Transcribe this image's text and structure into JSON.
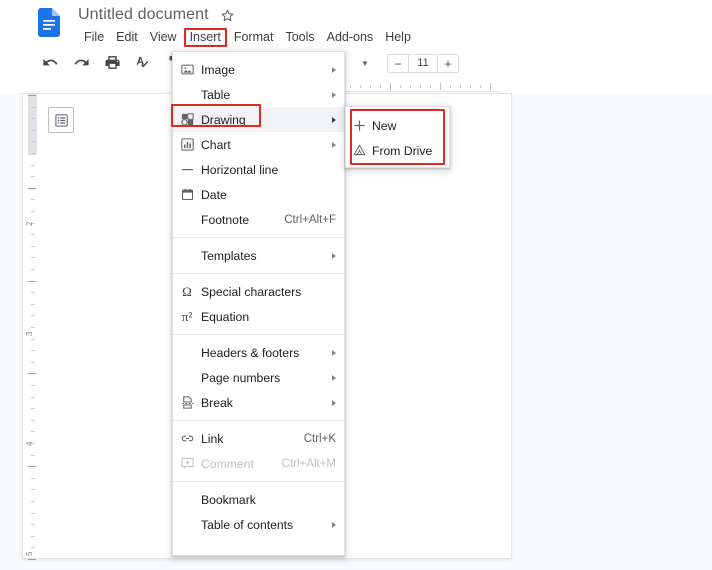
{
  "app": {
    "logo_icon": "google-docs-logo",
    "document_title": "Untitled document",
    "star_icon": "☆"
  },
  "menubar": {
    "items": [
      {
        "label": "File",
        "highlighted": false
      },
      {
        "label": "Edit",
        "highlighted": false
      },
      {
        "label": "View",
        "highlighted": false
      },
      {
        "label": "Insert",
        "highlighted": true
      },
      {
        "label": "Format",
        "highlighted": false
      },
      {
        "label": "Tools",
        "highlighted": false
      },
      {
        "label": "Add-ons",
        "highlighted": false
      },
      {
        "label": "Help",
        "highlighted": false
      }
    ]
  },
  "toolbar": {
    "icons": [
      {
        "name": "undo-icon"
      },
      {
        "name": "redo-icon"
      },
      {
        "name": "print-icon"
      },
      {
        "name": "spellcheck-icon"
      },
      {
        "name": "paint-format-icon"
      }
    ],
    "font_size": {
      "value": "11",
      "decrease_label": "−",
      "increase_label": "+"
    },
    "dropdown_caret": "▼"
  },
  "ruler": {
    "vertical_numbers": [
      "2",
      "3",
      "4",
      "5"
    ]
  },
  "document": {
    "outline_icon": "document-outline-icon"
  },
  "insert_menu": {
    "items": [
      {
        "label": "Image",
        "icon": "image-icon",
        "accel": "",
        "submenu": true,
        "separator_after": false,
        "disabled": false,
        "selected": false
      },
      {
        "label": "Table",
        "icon": "",
        "accel": "",
        "submenu": true,
        "separator_after": false,
        "disabled": false,
        "selected": false
      },
      {
        "label": "Drawing",
        "icon": "drawing-icon",
        "accel": "",
        "submenu": true,
        "separator_after": false,
        "disabled": false,
        "selected": true
      },
      {
        "label": "Chart",
        "icon": "chart-icon",
        "accel": "",
        "submenu": true,
        "separator_after": false,
        "disabled": false,
        "selected": false
      },
      {
        "label": "Horizontal line",
        "icon": "horizontal-line-icon",
        "accel": "",
        "submenu": false,
        "separator_after": false,
        "disabled": false,
        "selected": false
      },
      {
        "label": "Date",
        "icon": "date-icon",
        "accel": "",
        "submenu": false,
        "separator_after": false,
        "disabled": false,
        "selected": false
      },
      {
        "label": "Footnote",
        "icon": "",
        "accel": "Ctrl+Alt+F",
        "submenu": false,
        "separator_after": true,
        "disabled": false,
        "selected": false
      },
      {
        "label": "Templates",
        "icon": "",
        "accel": "",
        "submenu": true,
        "separator_after": true,
        "disabled": false,
        "selected": false
      },
      {
        "label": "Special characters",
        "icon": "omega-icon",
        "accel": "",
        "submenu": false,
        "separator_after": false,
        "disabled": false,
        "selected": false
      },
      {
        "label": "Equation",
        "icon": "equation-icon",
        "accel": "",
        "submenu": false,
        "separator_after": true,
        "disabled": false,
        "selected": false
      },
      {
        "label": "Headers & footers",
        "icon": "",
        "accel": "",
        "submenu": true,
        "separator_after": false,
        "disabled": false,
        "selected": false
      },
      {
        "label": "Page numbers",
        "icon": "",
        "accel": "",
        "submenu": true,
        "separator_after": false,
        "disabled": false,
        "selected": false
      },
      {
        "label": "Break",
        "icon": "break-icon",
        "accel": "",
        "submenu": true,
        "separator_after": true,
        "disabled": false,
        "selected": false
      },
      {
        "label": "Link",
        "icon": "link-icon",
        "accel": "Ctrl+K",
        "submenu": false,
        "separator_after": false,
        "disabled": false,
        "selected": false
      },
      {
        "label": "Comment",
        "icon": "comment-icon",
        "accel": "Ctrl+Alt+M",
        "submenu": false,
        "separator_after": true,
        "disabled": true,
        "selected": false
      },
      {
        "label": "Bookmark",
        "icon": "",
        "accel": "",
        "submenu": false,
        "separator_after": false,
        "disabled": false,
        "selected": false
      },
      {
        "label": "Table of contents",
        "icon": "",
        "accel": "",
        "submenu": true,
        "separator_after": false,
        "disabled": false,
        "selected": false
      }
    ]
  },
  "drawing_submenu": {
    "items": [
      {
        "label": "New",
        "icon": "plus-icon"
      },
      {
        "label": "From Drive",
        "icon": "drive-icon"
      }
    ]
  },
  "annotations": {
    "highlight_color": "#e02a21",
    "boxes": [
      "insert-menu-label",
      "drawing-menu-item",
      "drawing-submenu"
    ]
  }
}
